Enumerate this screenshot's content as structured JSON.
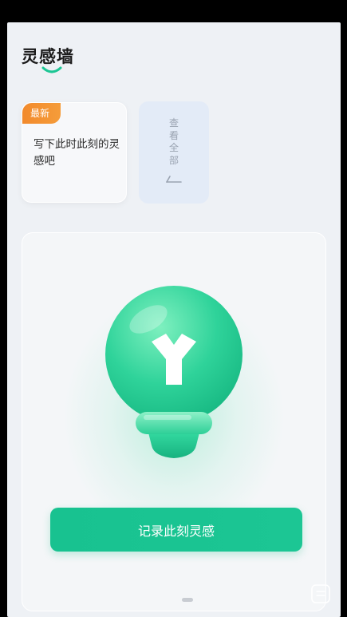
{
  "header": {
    "title": "灵感墙"
  },
  "latest_card": {
    "badge": "最新",
    "text": "写下此时此刻的灵感吧"
  },
  "view_all": {
    "label": "查看全部"
  },
  "main": {
    "button_label": "记录此刻灵感"
  },
  "colors": {
    "accent": "#1cc694",
    "badge": "#f28a2c",
    "background": "#eef1f5"
  },
  "icons": [
    "smile-underline-icon",
    "arrow-left-icon",
    "lightbulb-icon",
    "note-icon"
  ]
}
